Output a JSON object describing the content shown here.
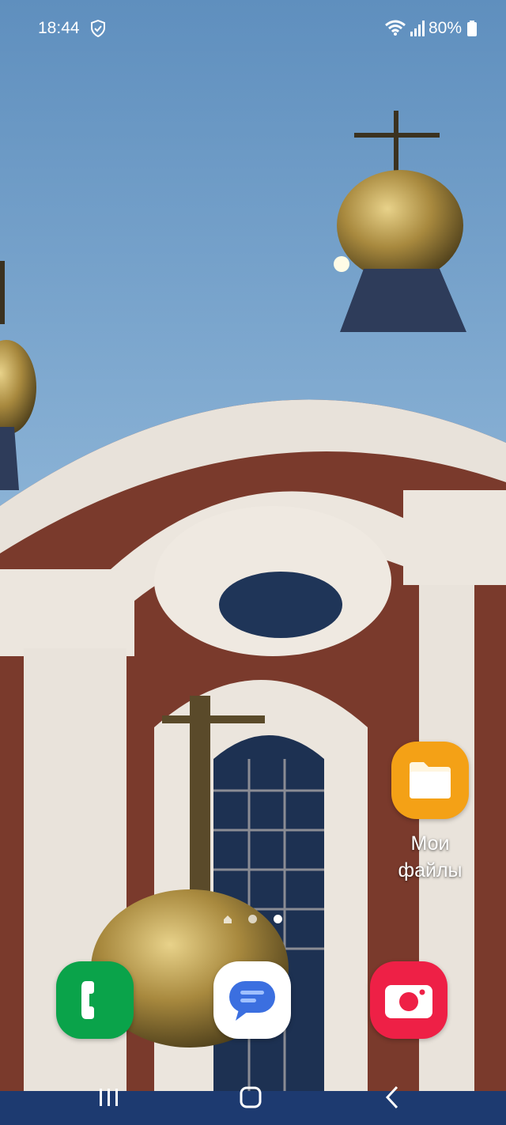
{
  "status_bar": {
    "time": "18:44",
    "battery": "80%",
    "icons": [
      "shield-icon",
      "wifi-icon",
      "signal-icon",
      "battery-icon"
    ]
  },
  "home_screen": {
    "apps": [
      {
        "label": "Мои\nфайлы",
        "icon": "folder-icon",
        "color": "#f4a116"
      }
    ],
    "page_indicator": {
      "pages": [
        "home",
        "page",
        "page"
      ],
      "active_index": 2
    }
  },
  "dock": {
    "apps": [
      {
        "icon": "phone-icon",
        "color": "#0aa34a"
      },
      {
        "icon": "messages-icon",
        "color": "#ffffff"
      },
      {
        "icon": "camera-icon",
        "color": "#ee2046"
      }
    ]
  },
  "navigation": {
    "buttons": [
      "recents-icon",
      "home-icon",
      "back-icon"
    ]
  }
}
